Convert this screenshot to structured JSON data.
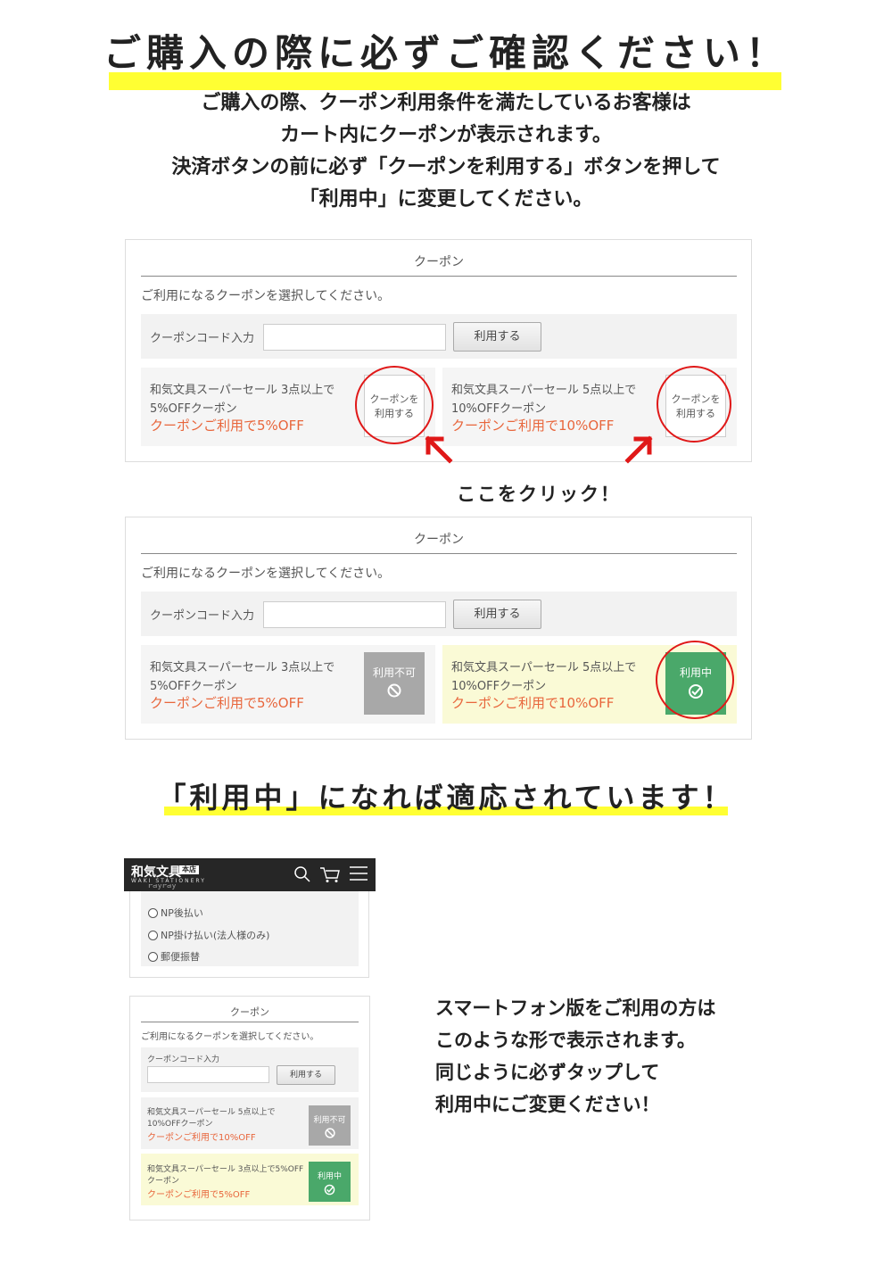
{
  "headline1": "ご購入の際に必ずご確認ください！",
  "intro": [
    "ご購入の際、クーポン利用条件を満たしているお客様は",
    "カート内にクーポンが表示されます。",
    "決済ボタンの前に必ず「クーポンを利用する」ボタンを押して",
    "「利用中」に変更してください。"
  ],
  "coupon": {
    "title": "クーポン",
    "description": "ご利用になるクーポンを選択してください。",
    "code_label": "クーポンコード入力",
    "apply_label": "利用する",
    "coupons": [
      {
        "line1": "和気文具スーパーセール 3点以上で",
        "line2": "5%OFFクーポン",
        "discount": "クーポンご利用で5%OFF"
      },
      {
        "line1": "和気文具スーパーセール 5点以上で",
        "line2": "10%OFFクーポン",
        "discount": "クーポンご利用で10%OFF"
      }
    ],
    "use_button": [
      "クーポンを",
      "利用する"
    ],
    "unavailable_label": "利用不可",
    "in_use_label": "利用中"
  },
  "click_here": "ここをクリック！",
  "headline2": "「利用中」になれば適応されています！",
  "mobile": {
    "logo": "和気文具",
    "badge": "本店",
    "logo_sub": "WAKI STATIONERY",
    "partial_option": "PayPay",
    "payment_options": [
      "NP後払い",
      "NP掛け払い(法人様のみ)",
      "郵便振替"
    ],
    "coupon_title": "クーポン",
    "coupon_description": "ご利用になるクーポンを選択してください。",
    "code_label": "クーポンコード入力",
    "apply_label": "利用する",
    "coupons": [
      {
        "line1": "和気文具スーパーセール 5点以上で",
        "line2": "10%OFFクーポン",
        "discount": "クーポンご利用で10%OFF",
        "status": "利用不可"
      },
      {
        "line1": "和気文具スーパーセール 3点以上で5%OFF",
        "line2": "クーポン",
        "discount": "クーポンご利用で5%OFF",
        "status": "利用中"
      }
    ]
  },
  "phone_note": [
    "スマートフォン版をご利用の方は",
    "このような形で表示されます。",
    "同じように必ずタップして",
    "利用中にご変更ください！"
  ],
  "colors": {
    "highlight": "#ffff33",
    "discount": "#e8663c",
    "active": "#4aa86a",
    "unavailable": "#a8a8a8",
    "circle": "#e01818"
  }
}
